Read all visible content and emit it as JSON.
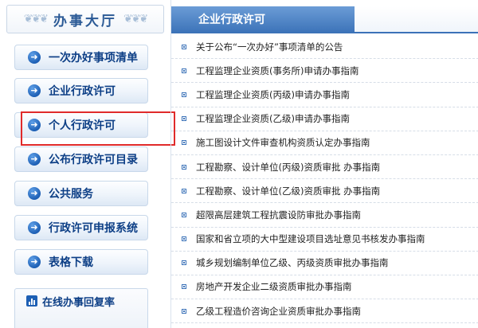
{
  "sidebar": {
    "hall_title": "办事大厅",
    "nav": [
      {
        "label": "一次办好事项清单",
        "icon": "arrow-right-circle-icon"
      },
      {
        "label": "企业行政许可",
        "icon": "arrow-right-circle-icon"
      },
      {
        "label": "个人行政许可",
        "icon": "arrow-right-circle-icon"
      },
      {
        "label": "公布行政许可目录",
        "icon": "arrow-right-circle-icon"
      },
      {
        "label": "公共服务",
        "icon": "arrow-right-circle-icon"
      },
      {
        "label": "行政许可申报系统",
        "icon": "arrow-right-circle-icon"
      },
      {
        "label": "表格下载",
        "icon": "arrow-right-circle-icon"
      }
    ],
    "highlighted_item": "个人行政许可",
    "rate_panel": {
      "label": "在线办事回复率",
      "icon": "bar-chart-icon"
    }
  },
  "main": {
    "title": "企业行政许可",
    "items": [
      {
        "text": "关于公布“一次办好”事项清单的公告"
      },
      {
        "text": "工程监理企业资质(事务所)申请办事指南"
      },
      {
        "text": "工程监理企业资质(丙级)申请办事指南"
      },
      {
        "text": "工程监理企业资质(乙级)申请办事指南"
      },
      {
        "text": "施工图设计文件审查机构资质认定办事指南"
      },
      {
        "text": "工程勘察、设计单位(丙级)资质审批 办事指南"
      },
      {
        "text": "工程勘察、设计单位(乙级)资质审批 办事指南"
      },
      {
        "text": "超限高层建筑工程抗震设防审批办事指南"
      },
      {
        "text": "国家和省立项的大中型建设项目选址意见书核发办事指南"
      },
      {
        "text": "城乡规划编制单位乙级、丙级资质审批办事指南"
      },
      {
        "text": "房地产开发企业二级资质审批办事指南"
      },
      {
        "text": "乙级工程造价咨询企业资质审批办事指南"
      }
    ]
  },
  "colors": {
    "accent": "#1d5fb4",
    "nav_text": "#0d3f86",
    "highlight": "#e02a2a"
  }
}
